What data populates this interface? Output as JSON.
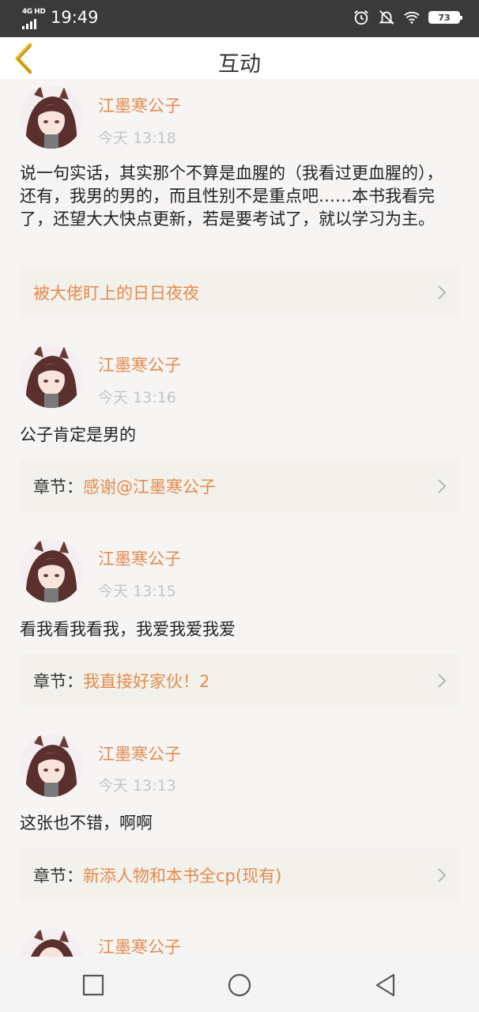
{
  "status_bar": {
    "network": "4G HD",
    "time": "19:49",
    "battery": "73",
    "icons": [
      "alarm-icon",
      "mute-icon",
      "wifi-icon",
      "battery-icon"
    ]
  },
  "header": {
    "title": "互动",
    "back_icon": "chevron-left-icon"
  },
  "colors": {
    "accent": "#e58b4f",
    "back_arrow": "#e8b820",
    "ref_bg": "#f2f1eb"
  },
  "comments": [
    {
      "username": "江墨寒公子",
      "time": "今天 13:18",
      "text": "说一句实话，其实那个不算是血腥的（我看过更血腥的），还有，我男的男的，而且性别不是重点吧……本书我看完了，还望大大快点更新，若是要考试了，就以学习为主。",
      "ref_prefix": "",
      "ref_title": "被大佬盯上的日日夜夜"
    },
    {
      "username": "江墨寒公子",
      "time": "今天 13:16",
      "text": "公子肯定是男的",
      "ref_prefix": "章节：",
      "ref_title": "感谢@江墨寒公子"
    },
    {
      "username": "江墨寒公子",
      "time": "今天 13:15",
      "text": "看我看我看我，我爱我爱我爱",
      "ref_prefix": "章节：",
      "ref_title": "我直接好家伙！2"
    },
    {
      "username": "江墨寒公子",
      "time": "今天 13:13",
      "text": "这张也不错，啊啊",
      "ref_prefix": "章节：",
      "ref_title": "新添人物和本书全cp(现有)"
    },
    {
      "username": "江墨寒公子"
    }
  ],
  "nav": {
    "icons": [
      "recent-apps-icon",
      "home-icon",
      "back-icon"
    ]
  }
}
